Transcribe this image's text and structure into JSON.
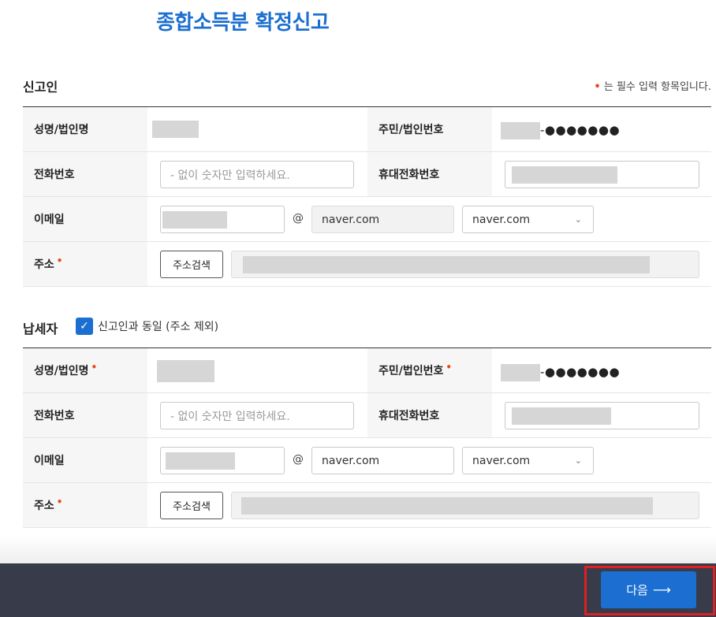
{
  "page_title": "종합소득분 확정신고",
  "required_note": "는 필수 입력 항목입니다.",
  "required_marker": "•",
  "reporter": {
    "section_title": "신고인",
    "name_label": "성명/법인명",
    "id_label": "주민/법인번호",
    "id_masked": "-●●●●●●●",
    "phone_label": "전화번호",
    "phone_placeholder": "- 없이 숫자만 입력하세요.",
    "mobile_label": "휴대전화번호",
    "email_label": "이메일",
    "email_at": "@",
    "email_domain": "naver.com",
    "email_domain_select": "naver.com",
    "address_label": "주소",
    "address_search": "주소검색"
  },
  "taxpayer": {
    "section_title": "납세자",
    "same_as_reporter": "신고인과 동일 (주소 제외)",
    "name_label": "성명/법인명",
    "id_label": "주민/법인번호",
    "id_masked": "-●●●●●●●",
    "phone_label": "전화번호",
    "phone_placeholder": "- 없이 숫자만 입력하세요.",
    "mobile_label": "휴대전화번호",
    "email_label": "이메일",
    "email_at": "@",
    "email_domain": "naver.com",
    "email_domain_select": "naver.com",
    "address_label": "주소",
    "address_search": "주소검색"
  },
  "footer": {
    "next_label": "다음",
    "next_arrow": "⟶"
  },
  "colors": {
    "accent": "#1c6fd1",
    "required": "#e84a1a",
    "footer_bg": "#383b49",
    "highlight": "#e02020"
  }
}
